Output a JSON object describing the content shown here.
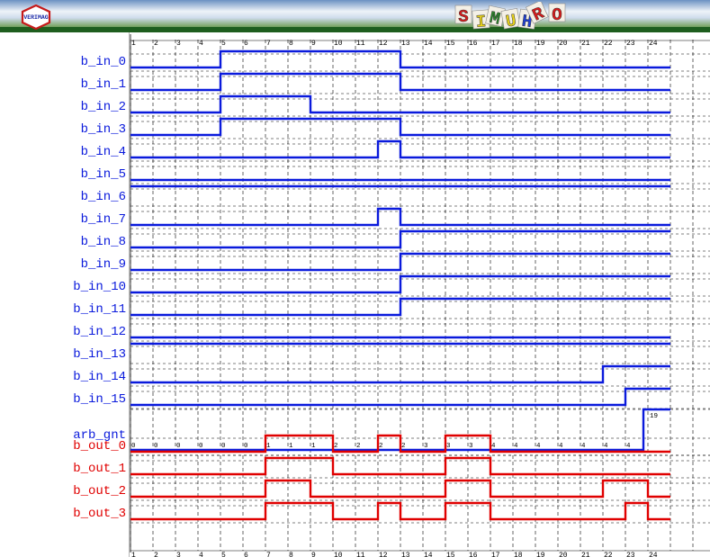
{
  "header": {
    "logo_text": "VERIMAG",
    "title_letters": [
      "S",
      "I",
      "M",
      "U",
      "H",
      "R",
      "O"
    ],
    "title_colors": [
      "#d81b1b",
      "#e8d21a",
      "#2a8a2a",
      "#e8d21a",
      "#1f3fd1",
      "#d81b1b",
      "#d81b1b"
    ]
  },
  "timeline": {
    "cycles": 24,
    "ticks_top": [
      "1",
      "2",
      "3",
      "4",
      "5",
      "6",
      "7",
      "8",
      "9",
      "10",
      "11",
      "12",
      "13",
      "14",
      "15",
      "16",
      "17",
      "18",
      "19",
      "20",
      "21",
      "22",
      "23",
      "24"
    ],
    "ticks_bottom": [
      "1",
      "2",
      "3",
      "4",
      "5",
      "6",
      "7",
      "8",
      "9",
      "10",
      "11",
      "12",
      "13",
      "14",
      "15",
      "16",
      "17",
      "18",
      "19",
      "20",
      "21",
      "22",
      "23",
      "24"
    ]
  },
  "colors": {
    "input": "#0a1adc",
    "output": "#e00000",
    "label_input": "#0a1adc",
    "label_output": "#e00000",
    "grid": "#000000"
  },
  "signals": [
    {
      "name": "b_in_0",
      "kind": "input",
      "changes": [
        [
          0,
          0
        ],
        [
          4,
          1
        ],
        [
          12,
          0
        ]
      ]
    },
    {
      "name": "b_in_1",
      "kind": "input",
      "changes": [
        [
          0,
          0
        ],
        [
          4,
          1
        ],
        [
          12,
          0
        ]
      ]
    },
    {
      "name": "b_in_2",
      "kind": "input",
      "changes": [
        [
          0,
          0
        ],
        [
          4,
          1
        ],
        [
          8,
          0
        ]
      ]
    },
    {
      "name": "b_in_3",
      "kind": "input",
      "changes": [
        [
          0,
          0
        ],
        [
          4,
          1
        ],
        [
          12,
          0
        ]
      ]
    },
    {
      "name": "b_in_4",
      "kind": "input",
      "changes": [
        [
          0,
          0
        ],
        [
          11,
          1
        ],
        [
          12,
          0
        ]
      ]
    },
    {
      "name": "b_in_5",
      "kind": "input",
      "changes": [
        [
          0,
          0
        ]
      ]
    },
    {
      "name": "b_in_6",
      "kind": "input",
      "changes": [
        [
          0,
          1
        ]
      ]
    },
    {
      "name": "b_in_7",
      "kind": "input",
      "changes": [
        [
          0,
          0
        ],
        [
          11,
          1
        ],
        [
          12,
          0
        ]
      ]
    },
    {
      "name": "b_in_8",
      "kind": "input",
      "changes": [
        [
          0,
          0
        ],
        [
          12,
          1
        ]
      ]
    },
    {
      "name": "b_in_9",
      "kind": "input",
      "changes": [
        [
          0,
          0
        ],
        [
          12,
          1
        ]
      ]
    },
    {
      "name": "b_in_10",
      "kind": "input",
      "changes": [
        [
          0,
          0
        ],
        [
          12,
          1
        ]
      ]
    },
    {
      "name": "b_in_11",
      "kind": "input",
      "changes": [
        [
          0,
          0
        ],
        [
          12,
          1
        ]
      ]
    },
    {
      "name": "b_in_12",
      "kind": "input",
      "changes": [
        [
          0,
          0
        ]
      ]
    },
    {
      "name": "b_in_13",
      "kind": "input",
      "changes": [
        [
          0,
          1
        ]
      ]
    },
    {
      "name": "b_in_14",
      "kind": "input",
      "changes": [
        [
          0,
          0
        ],
        [
          21,
          1
        ]
      ]
    },
    {
      "name": "b_in_15",
      "kind": "input",
      "changes": [
        [
          0,
          0
        ],
        [
          22,
          1
        ]
      ]
    },
    {
      "name": "arb_gnt",
      "kind": "bus",
      "values": [
        "0",
        "0",
        "0",
        "0",
        "0",
        "0",
        "1",
        "1",
        "1",
        "2",
        "2",
        "2",
        "2",
        "3",
        "3",
        "3",
        "4",
        "4",
        "4",
        "4",
        "4",
        "4",
        "4",
        "19"
      ]
    },
    {
      "name": "b_out_0",
      "kind": "output",
      "changes": [
        [
          0,
          0
        ],
        [
          6,
          1
        ],
        [
          9,
          0
        ],
        [
          11,
          1
        ],
        [
          12,
          0
        ],
        [
          14,
          1
        ],
        [
          16,
          0
        ]
      ]
    },
    {
      "name": "b_out_1",
      "kind": "output",
      "changes": [
        [
          0,
          0
        ],
        [
          6,
          1
        ],
        [
          9,
          0
        ],
        [
          14,
          1
        ],
        [
          16,
          0
        ]
      ]
    },
    {
      "name": "b_out_2",
      "kind": "output",
      "changes": [
        [
          0,
          0
        ],
        [
          6,
          1
        ],
        [
          8,
          0
        ],
        [
          14,
          1
        ],
        [
          16,
          0
        ],
        [
          21,
          1
        ],
        [
          23,
          0
        ]
      ]
    },
    {
      "name": "b_out_3",
      "kind": "output",
      "changes": [
        [
          0,
          0
        ],
        [
          6,
          1
        ],
        [
          9,
          0
        ],
        [
          11,
          1
        ],
        [
          12,
          0
        ],
        [
          14,
          1
        ],
        [
          16,
          0
        ],
        [
          22,
          1
        ],
        [
          23,
          0
        ]
      ]
    }
  ]
}
